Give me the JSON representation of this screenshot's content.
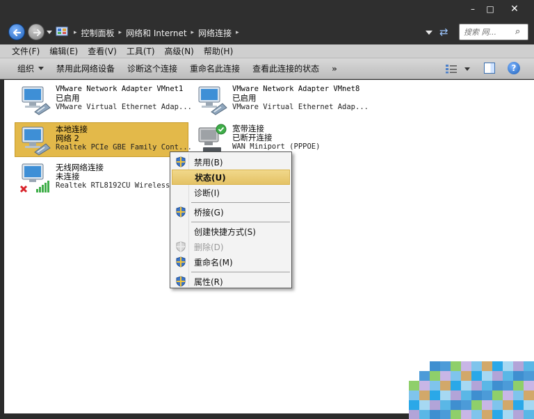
{
  "window": {
    "minimize": "–",
    "maximize": "□",
    "close": "✕"
  },
  "address": {
    "crumbs": [
      "控制面板",
      "网络和 Internet",
      "网络连接"
    ],
    "search_placeholder": "搜索 网..."
  },
  "menubar": [
    "文件(F)",
    "编辑(E)",
    "查看(V)",
    "工具(T)",
    "高级(N)",
    "帮助(H)"
  ],
  "toolbar": {
    "organize": "组织",
    "disable": "禁用此网络设备",
    "diagnose": "诊断这个连接",
    "rename": "重命名此连接",
    "view_status": "查看此连接的状态",
    "more": "»"
  },
  "connections": [
    {
      "name": "VMware Network Adapter VMnet1",
      "status": "已启用",
      "device": "VMware Virtual Ethernet Adap..."
    },
    {
      "name": "VMware Network Adapter VMnet8",
      "status": "已启用",
      "device": "VMware Virtual Ethernet Adap..."
    },
    {
      "name": "本地连接",
      "status": "网络  2",
      "device": "Realtek PCIe GBE Family Cont..."
    },
    {
      "name": "宽带连接",
      "status": "已断开连接",
      "device": "WAN Miniport (PPPOE)"
    },
    {
      "name": "无线网络连接",
      "status": "未连接",
      "device": "Realtek RTL8192CU Wireless L"
    }
  ],
  "context_menu": [
    {
      "label": "禁用(B)",
      "shield": true
    },
    {
      "label": "状态(U)",
      "shield": false,
      "highlighted": true
    },
    {
      "label": "诊断(I)",
      "shield": false
    },
    {
      "label": "桥接(G)",
      "shield": true
    },
    {
      "label": "创建快捷方式(S)",
      "shield": false
    },
    {
      "label": "删除(D)",
      "shield": true,
      "disabled": true
    },
    {
      "label": "重命名(M)",
      "shield": true
    },
    {
      "label": "属性(R)",
      "shield": true
    }
  ],
  "colors": {
    "selection": "#e3b94a",
    "menu_highlight": "#e4c265",
    "chrome": "#2f2f2f"
  }
}
